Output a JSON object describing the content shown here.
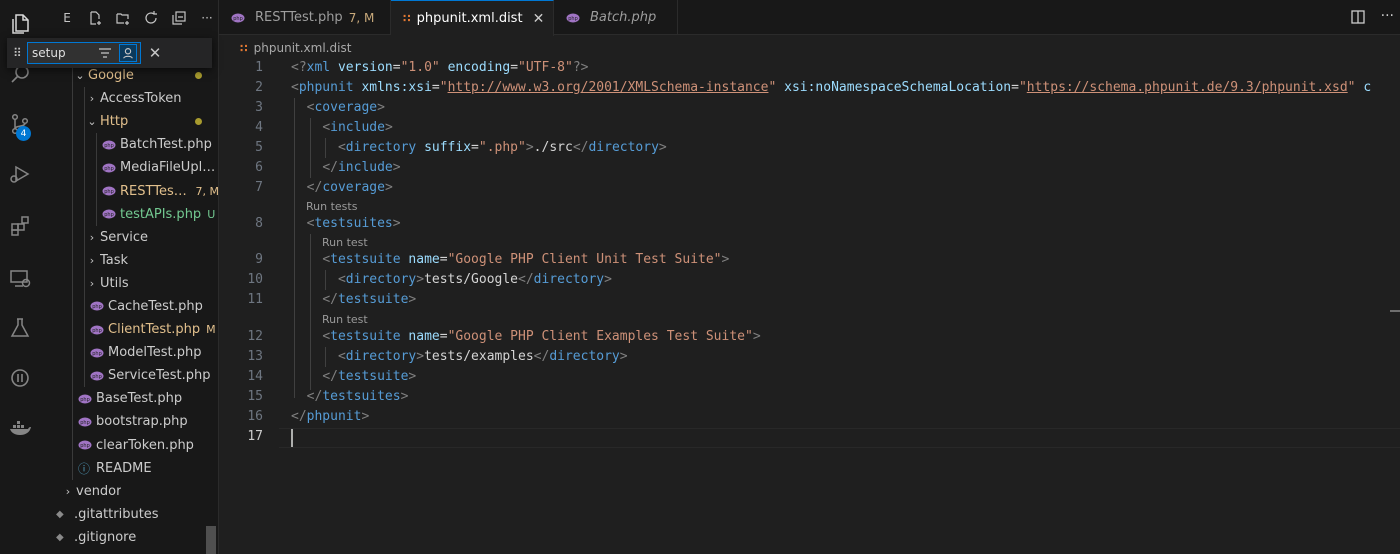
{
  "sidebar": {
    "toolbar_label": "E",
    "find": {
      "value": "setup",
      "grip": "⠿",
      "close": "✕"
    },
    "tree": [
      {
        "id": "google",
        "label": "Google",
        "depth": 1,
        "chevron": "⌄",
        "folder": true,
        "dot": true,
        "status": "mod"
      },
      {
        "id": "accesstoken",
        "label": "AccessToken",
        "depth": 2,
        "chevron": "›",
        "folder": true
      },
      {
        "id": "http",
        "label": "Http",
        "depth": 2,
        "chevron": "⌄",
        "folder": true,
        "dot": true,
        "status": "mod"
      },
      {
        "id": "batchtest",
        "label": "BatchTest.php",
        "depth": 3,
        "php": true
      },
      {
        "id": "mediafileupload",
        "label": "MediaFileUpload...",
        "depth": 3,
        "php": true
      },
      {
        "id": "resttest",
        "label": "RESTTest....",
        "depth": 3,
        "php": true,
        "decoration": "7, M",
        "status": "mod"
      },
      {
        "id": "testapis",
        "label": "testAPIs.php",
        "depth": 3,
        "php": true,
        "decoration": "U",
        "status": "untracked"
      },
      {
        "id": "service",
        "label": "Service",
        "depth": 2,
        "chevron": "›",
        "folder": true
      },
      {
        "id": "task",
        "label": "Task",
        "depth": 2,
        "chevron": "›",
        "folder": true
      },
      {
        "id": "utils",
        "label": "Utils",
        "depth": 2,
        "chevron": "›",
        "folder": true
      },
      {
        "id": "cachetest",
        "label": "CacheTest.php",
        "depth": 2,
        "php": true
      },
      {
        "id": "clienttest",
        "label": "ClientTest.php",
        "depth": 2,
        "php": true,
        "decoration": "M",
        "status": "mod"
      },
      {
        "id": "modeltest",
        "label": "ModelTest.php",
        "depth": 2,
        "php": true
      },
      {
        "id": "servicetest",
        "label": "ServiceTest.php",
        "depth": 2,
        "php": true
      },
      {
        "id": "basetest",
        "label": "BaseTest.php",
        "depth": 1,
        "php": true
      },
      {
        "id": "bootstrap",
        "label": "bootstrap.php",
        "depth": 1,
        "php": true
      },
      {
        "id": "cleartoken",
        "label": "clearToken.php",
        "depth": 1,
        "php": true
      },
      {
        "id": "readme",
        "label": "README",
        "depth": 1,
        "info": true
      },
      {
        "id": "vendor",
        "label": "vendor",
        "depth": 0,
        "chevron": "›",
        "folder": true
      },
      {
        "id": "gitattributes",
        "label": ".gitattributes",
        "depth": 0,
        "git": true
      },
      {
        "id": "gitignore",
        "label": ".gitignore",
        "depth": 0,
        "git": true
      }
    ]
  },
  "tabs": [
    {
      "id": "resttest",
      "label": "RESTTest.php",
      "decoration": "7, M",
      "icon": "php-icon",
      "active": false,
      "italic": false
    },
    {
      "id": "phpunit",
      "label": "phpunit.xml.dist",
      "decoration": "",
      "icon": "rss-icon",
      "active": true,
      "italic": false,
      "close": "✕"
    },
    {
      "id": "batch",
      "label": "Batch.php",
      "decoration": "",
      "icon": "php-icon",
      "active": false,
      "italic": true
    }
  ],
  "breadcrumb": {
    "label": "phpunit.xml.dist"
  },
  "editor": {
    "lens_label_1": "Run tests",
    "lens_label_2": "Run test",
    "current_line": 17
  },
  "colors": {
    "accent": "#0078d4",
    "modified": "#e2c08d",
    "untracked": "#73c991",
    "php": "#a074c4",
    "xml_rss": "#e37933"
  }
}
